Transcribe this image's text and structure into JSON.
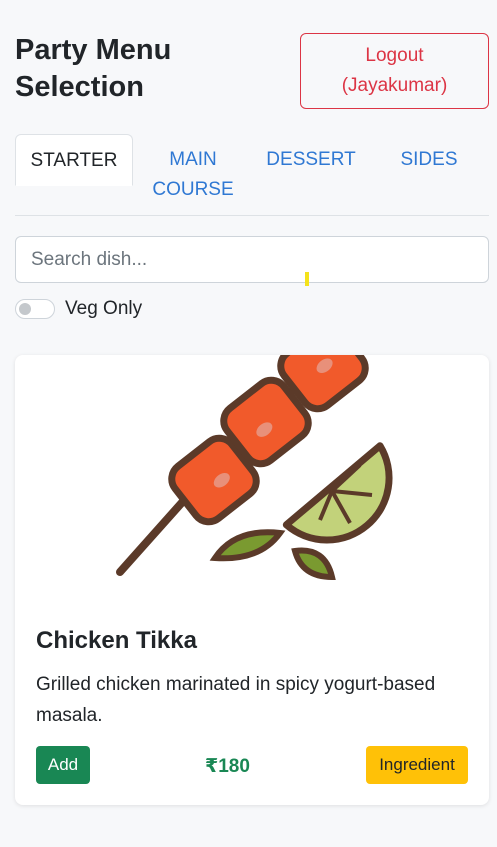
{
  "header": {
    "title": "Party Menu Selection",
    "logout_label": "Logout",
    "logout_user": "(Jayakumar)"
  },
  "tabs": [
    {
      "label": "STARTER",
      "active": true
    },
    {
      "label": "MAIN COURSE",
      "active": false
    },
    {
      "label": "DESSERT",
      "active": false
    },
    {
      "label": "SIDES",
      "active": false
    }
  ],
  "search": {
    "placeholder": "Search dish...",
    "value": ""
  },
  "filter": {
    "label": "Veg Only",
    "checked": false
  },
  "dishes": [
    {
      "name": "Chicken Tikka",
      "description": "Grilled chicken marinated in spicy yogurt-based masala.",
      "add_label": "Add",
      "price": "₹180",
      "ingredient_label": "Ingredient",
      "image_icon": "chicken-tikka-skewer-icon"
    }
  ],
  "colors": {
    "primary": "#2f78d3",
    "danger": "#dc3545",
    "success": "#198754",
    "warning": "#ffc107"
  }
}
